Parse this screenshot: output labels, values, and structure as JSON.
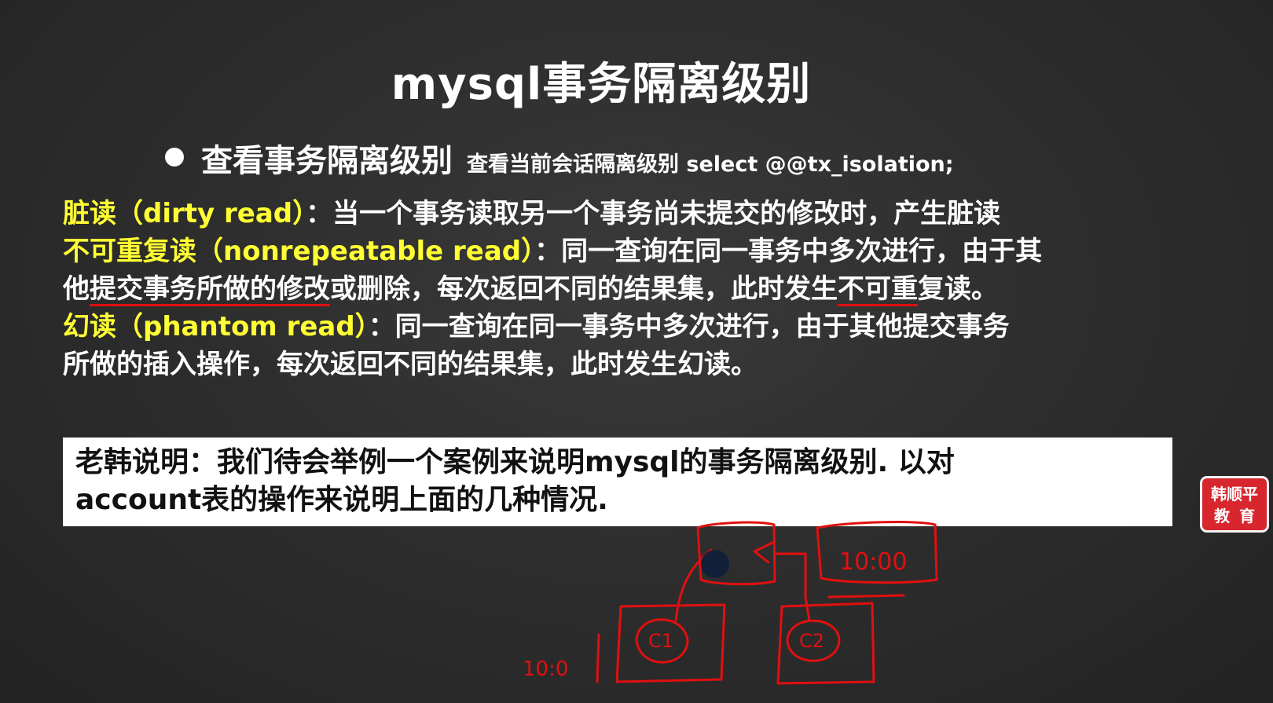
{
  "slide": {
    "title": "mysql事务隔离级别",
    "bullet": {
      "heading": "查看事务隔离级别",
      "subtext": "查看当前会话隔离级别 select @@tx_isolation;"
    },
    "definitions": {
      "dirty": {
        "term": "脏读（dirty read）",
        "desc": "：当一个事务读取另一个事务尚未提交的修改时，产生脏读"
      },
      "nonrepeatable": {
        "term": "不可重复读（nonrepeatable read）",
        "desc": "：同一查询在同一事务中多次进行，由于其",
        "l2_a": "他",
        "l2_b": "提交事务所做的修改",
        "l2_c": "或删除，每次返回不同的结果集，此时发生",
        "l2_d": "不可重",
        "l2_e": "复读。"
      },
      "phantom": {
        "term": "幻读（phantom read）",
        "desc": "：同一查询在同一事务中多次进行，由于其他提交事务",
        "l2": "所做的插入操作，每次返回不同的结果集，此时发生幻读。"
      }
    },
    "note": {
      "line1": "老韩说明：我们待会举例一个案例来说明mysql的事务隔离级别. 以对",
      "line2": "account表的操作来说明上面的几种情况."
    },
    "logo": {
      "line1": "韩顺平",
      "line2": "教育"
    }
  },
  "annotations": {
    "box_label": "10:00",
    "left_label": "10:0",
    "client1": "C1",
    "client2": "C2",
    "ink_color": "#e01010"
  },
  "colors": {
    "background": "#2e2e2e",
    "highlight": "#ffff33",
    "underline": "#e01010",
    "logo": "#d8262e"
  }
}
